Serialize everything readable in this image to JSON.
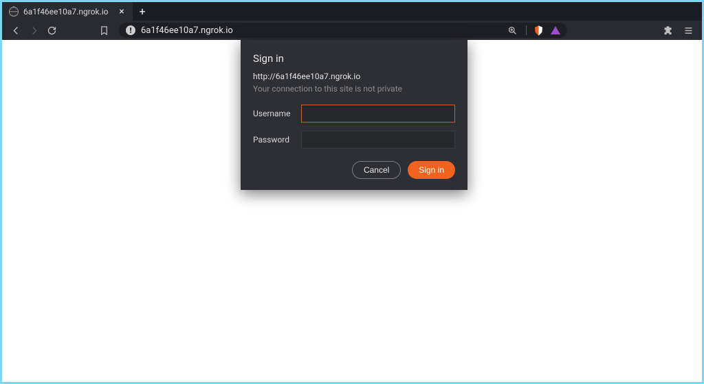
{
  "tab": {
    "title": "6a1f46ee10a7.ngrok.io"
  },
  "address_bar": {
    "url": "6a1f46ee10a7.ngrok.io"
  },
  "auth_dialog": {
    "title": "Sign in",
    "host": "http://6a1f46ee10a7.ngrok.io",
    "warning": "Your connection to this site is not private",
    "username_label": "Username",
    "password_label": "Password",
    "username_value": "",
    "password_value": "",
    "cancel_label": "Cancel",
    "signin_label": "Sign in"
  },
  "colors": {
    "accent": "#f0621e",
    "focus_border": "#d35a2a",
    "window_border": "#7ed5f2"
  }
}
